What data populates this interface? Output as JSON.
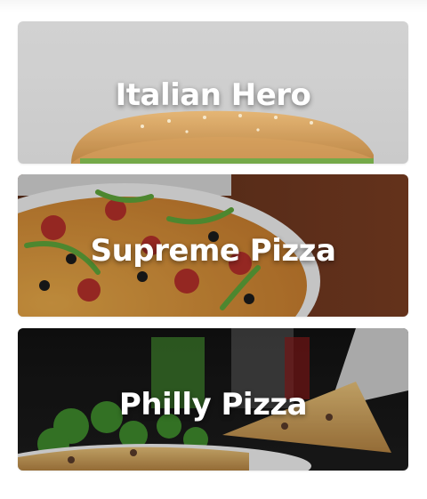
{
  "menu": {
    "items": [
      {
        "label": "Italian Hero",
        "image": "sub-sandwich-photo"
      },
      {
        "label": "Supreme Pizza",
        "image": "supreme-pizza-photo"
      },
      {
        "label": "Philly Pizza",
        "image": "philly-pizza-slice-photo"
      }
    ]
  },
  "colors": {
    "title_text": "#ffffff",
    "page_background": "#ffffff"
  }
}
